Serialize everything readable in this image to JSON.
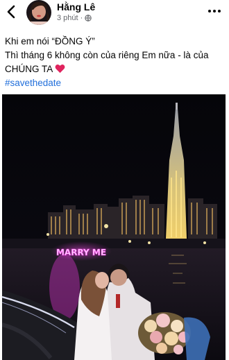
{
  "post": {
    "author": "Hằng Lê",
    "time": "3 phút ·",
    "text_line1": "Khi em nói “ĐỒNG Ý”",
    "text_line2": "Thì tháng 6 không còn của riêng Em nữa - là của",
    "text_line3": "CHÚNG TA",
    "hashtag": "#savethedate"
  },
  "photo": {
    "neon_sign": "MARRY ME"
  },
  "icons": {
    "back": "chevron-left-icon",
    "privacy": "globe-icon",
    "more": "more-horizontal-icon",
    "heart": "red-heart-emoji"
  },
  "colors": {
    "hashtag": "#216fdb",
    "meta_text": "#65676b",
    "neon": "#ff3df0"
  }
}
